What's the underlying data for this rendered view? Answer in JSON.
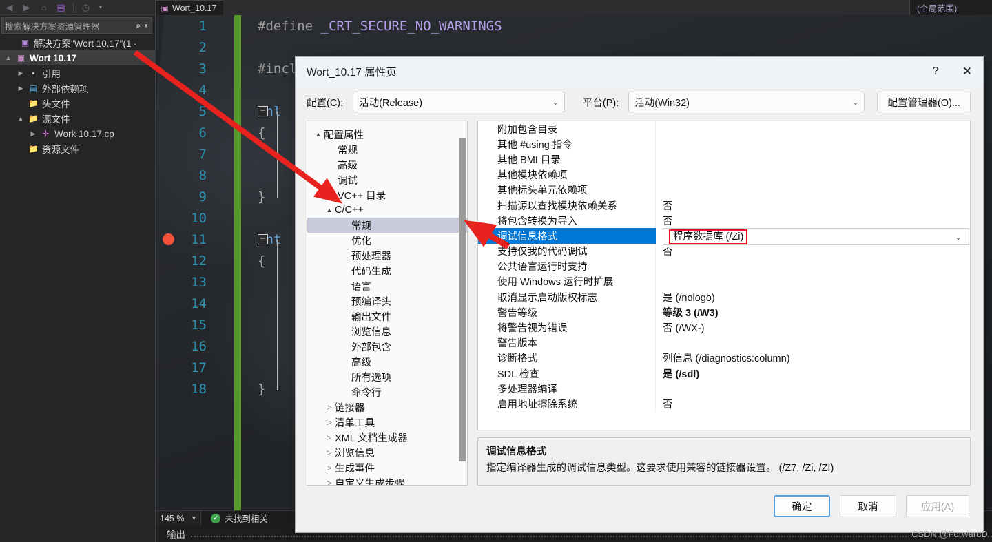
{
  "ide": {
    "solution_explorer": {
      "toolbar_icons": [
        "back-icon",
        "forward-icon",
        "home-icon",
        "vs-logo-icon",
        "history-icon",
        "chevron-down-icon"
      ],
      "search_placeholder": "搜索解决方案资源管理器",
      "search_icon": "search-icon",
      "tree": [
        {
          "label": "解决方案\"Wort 10.17\"(1 ·",
          "icon": "solution-icon",
          "twisty": "",
          "indent": 6,
          "selected": false,
          "bold": false
        },
        {
          "label": "Wort 10.17",
          "icon": "project-icon",
          "twisty": "▲",
          "indent": 0,
          "selected": true,
          "bold": true
        },
        {
          "label": "引用",
          "icon": "reference-icon",
          "twisty": "▶",
          "indent": 18,
          "selected": false,
          "bold": false
        },
        {
          "label": "外部依赖项",
          "icon": "external-deps-icon",
          "twisty": "▶",
          "indent": 18,
          "selected": false,
          "bold": false
        },
        {
          "label": "头文件",
          "icon": "folder-icon",
          "twisty": "",
          "indent": 18,
          "selected": false,
          "bold": false
        },
        {
          "label": "源文件",
          "icon": "folder-icon",
          "twisty": "▲",
          "indent": 18,
          "selected": false,
          "bold": false
        },
        {
          "label": "Work 10.17.cp",
          "icon": "cpp-file-icon",
          "twisty": "▶",
          "indent": 36,
          "selected": false,
          "bold": false
        },
        {
          "label": "资源文件",
          "icon": "folder-icon",
          "twisty": "",
          "indent": 18,
          "selected": false,
          "bold": false
        }
      ]
    },
    "editor": {
      "tab_label": "Wort_10.17",
      "scope_label": "(全局范围)",
      "lines": [
        {
          "n": "1",
          "text": "#define _CRT_SECURE_NO_WARNINGS",
          "kind": "define"
        },
        {
          "n": "2",
          "text": "",
          "kind": "blank"
        },
        {
          "n": "3",
          "text": "#include <stdio.h>",
          "kind": "include"
        },
        {
          "n": "4",
          "text": "",
          "kind": "blank"
        },
        {
          "n": "5",
          "text": "inl",
          "kind": "code",
          "fold": "−"
        },
        {
          "n": "6",
          "text": "{",
          "kind": "brace"
        },
        {
          "n": "7",
          "text": "",
          "kind": "blank"
        },
        {
          "n": "8",
          "text": "",
          "kind": "blank"
        },
        {
          "n": "9",
          "text": "}",
          "kind": "brace"
        },
        {
          "n": "10",
          "text": "",
          "kind": "blank"
        },
        {
          "n": "11",
          "text": "int",
          "kind": "code",
          "fold": "−",
          "breakpoint": true
        },
        {
          "n": "12",
          "text": "{",
          "kind": "brace"
        },
        {
          "n": "13",
          "text": "",
          "kind": "blank"
        },
        {
          "n": "14",
          "text": "",
          "kind": "blank"
        },
        {
          "n": "15",
          "text": "",
          "kind": "blank"
        },
        {
          "n": "16",
          "text": "",
          "kind": "blank"
        },
        {
          "n": "17",
          "text": "",
          "kind": "blank"
        },
        {
          "n": "18",
          "text": "}",
          "kind": "brace"
        }
      ]
    },
    "status": {
      "zoom": "145 %",
      "message": "未找到相关",
      "ok_icon": "check-circle-icon",
      "output_label": "输出"
    }
  },
  "dialog": {
    "title": "Wort_10.17 属性页",
    "help_button": "?",
    "close_button": "✕",
    "config_label": "配置(C):",
    "config_value": "活动(Release)",
    "platform_label": "平台(P):",
    "platform_value": "活动(Win32)",
    "config_manager_button": "配置管理器(O)...",
    "tree": [
      {
        "label": "配置属性",
        "twisty": "▲",
        "indent": 8,
        "selected": false
      },
      {
        "label": "常规",
        "twisty": "",
        "indent": 28,
        "selected": false
      },
      {
        "label": "高级",
        "twisty": "",
        "indent": 28,
        "selected": false
      },
      {
        "label": "调试",
        "twisty": "",
        "indent": 28,
        "selected": false
      },
      {
        "label": "VC++ 目录",
        "twisty": "",
        "indent": 28,
        "selected": false
      },
      {
        "label": "C/C++",
        "twisty": "▲",
        "indent": 24,
        "selected": false
      },
      {
        "label": "常规",
        "twisty": "",
        "indent": 48,
        "selected": true
      },
      {
        "label": "优化",
        "twisty": "",
        "indent": 48,
        "selected": false
      },
      {
        "label": "预处理器",
        "twisty": "",
        "indent": 48,
        "selected": false
      },
      {
        "label": "代码生成",
        "twisty": "",
        "indent": 48,
        "selected": false
      },
      {
        "label": "语言",
        "twisty": "",
        "indent": 48,
        "selected": false
      },
      {
        "label": "预编译头",
        "twisty": "",
        "indent": 48,
        "selected": false
      },
      {
        "label": "输出文件",
        "twisty": "",
        "indent": 48,
        "selected": false
      },
      {
        "label": "浏览信息",
        "twisty": "",
        "indent": 48,
        "selected": false
      },
      {
        "label": "外部包含",
        "twisty": "",
        "indent": 48,
        "selected": false
      },
      {
        "label": "高级",
        "twisty": "",
        "indent": 48,
        "selected": false
      },
      {
        "label": "所有选项",
        "twisty": "",
        "indent": 48,
        "selected": false
      },
      {
        "label": "命令行",
        "twisty": "",
        "indent": 48,
        "selected": false
      },
      {
        "label": "链接器",
        "twisty": "▷",
        "indent": 24,
        "selected": false
      },
      {
        "label": "清单工具",
        "twisty": "▷",
        "indent": 24,
        "selected": false
      },
      {
        "label": "XML 文档生成器",
        "twisty": "▷",
        "indent": 24,
        "selected": false
      },
      {
        "label": "浏览信息",
        "twisty": "▷",
        "indent": 24,
        "selected": false
      },
      {
        "label": "生成事件",
        "twisty": "▷",
        "indent": 24,
        "selected": false
      },
      {
        "label": "自定义生成步骤",
        "twisty": "▷",
        "indent": 24,
        "selected": false
      }
    ],
    "properties": [
      {
        "name": "附加包含目录",
        "value": "",
        "selected": false,
        "bold": false
      },
      {
        "name": "其他 #using 指令",
        "value": "",
        "selected": false,
        "bold": false
      },
      {
        "name": "其他 BMI 目录",
        "value": "",
        "selected": false,
        "bold": false
      },
      {
        "name": "其他模块依赖项",
        "value": "",
        "selected": false,
        "bold": false
      },
      {
        "name": "其他标头单元依赖项",
        "value": "",
        "selected": false,
        "bold": false
      },
      {
        "name": "扫描源以查找模块依赖关系",
        "value": "否",
        "selected": false,
        "bold": false
      },
      {
        "name": "将包含转换为导入",
        "value": "否",
        "selected": false,
        "bold": false
      },
      {
        "name": "调试信息格式",
        "value": "程序数据库 (/Zi)",
        "selected": true,
        "bold": false
      },
      {
        "name": "支持仅我的代码调试",
        "value": "否",
        "selected": false,
        "bold": false
      },
      {
        "name": "公共语言运行时支持",
        "value": "",
        "selected": false,
        "bold": false
      },
      {
        "name": "使用 Windows 运行时扩展",
        "value": "",
        "selected": false,
        "bold": false
      },
      {
        "name": "取消显示启动版权标志",
        "value": "是 (/nologo)",
        "selected": false,
        "bold": false
      },
      {
        "name": "警告等级",
        "value": "等级 3 (/W3)",
        "selected": false,
        "bold": true
      },
      {
        "name": "将警告视为错误",
        "value": "否 (/WX-)",
        "selected": false,
        "bold": false
      },
      {
        "name": "警告版本",
        "value": "",
        "selected": false,
        "bold": false
      },
      {
        "name": "诊断格式",
        "value": "列信息 (/diagnostics:column)",
        "selected": false,
        "bold": false
      },
      {
        "name": "SDL 检查",
        "value": "是 (/sdl)",
        "selected": false,
        "bold": true
      },
      {
        "name": "多处理器编译",
        "value": "",
        "selected": false,
        "bold": false
      },
      {
        "name": "启用地址擦除系统",
        "value": "否",
        "selected": false,
        "bold": false
      }
    ],
    "selected_value": "程序数据库 (/Zi)",
    "description": {
      "title": "调试信息格式",
      "text": "指定编译器生成的调试信息类型。这要求使用兼容的链接器设置。  (/Z7, /Zi, /ZI)"
    },
    "footer": {
      "ok": "确定",
      "cancel": "取消",
      "apply": "应用(A)"
    }
  },
  "watermark": "CSDN @ForwardD",
  "colors": {
    "accent_blue": "#0078d7",
    "highlight_red": "#e81123",
    "arrow_red": "#e8231f",
    "tree_select": "#c8cbdb",
    "dialog_bg": "#f0f0f0",
    "titlebar_bg": "#eef3f8",
    "changebar_green": "#57992b",
    "breakpoint_red": "#f4523b"
  }
}
